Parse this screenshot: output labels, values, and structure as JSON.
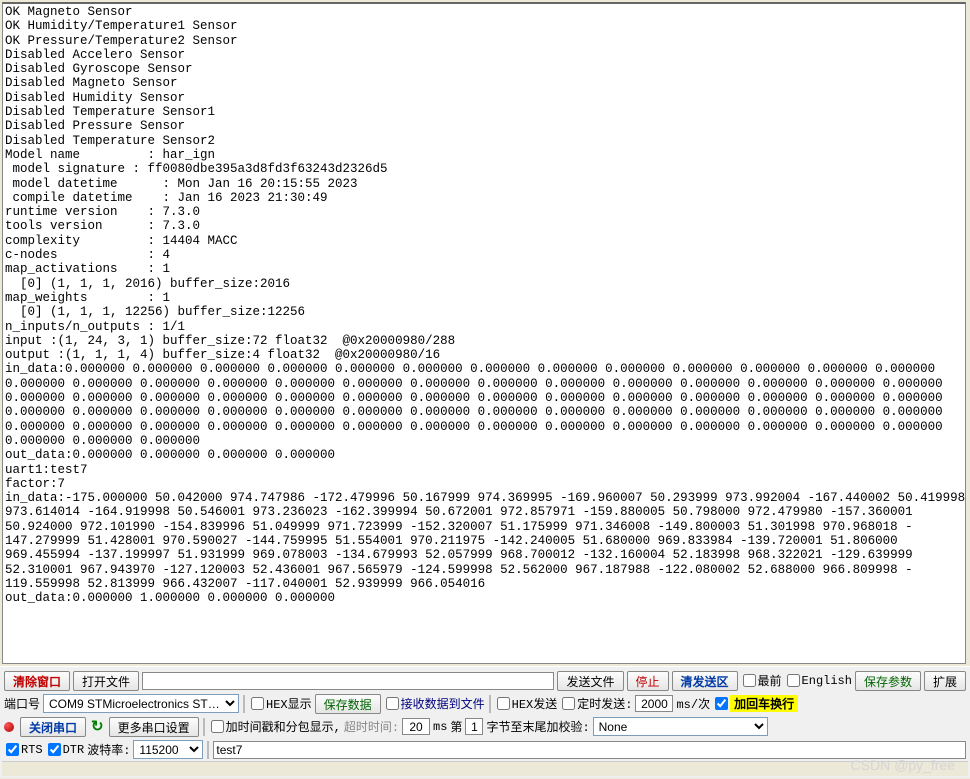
{
  "output_lines": [
    "OK Magneto Sensor",
    "OK Humidity/Temperature1 Sensor",
    "OK Pressure/Temperature2 Sensor",
    "Disabled Accelero Sensor",
    "Disabled Gyroscope Sensor",
    "Disabled Magneto Sensor",
    "Disabled Humidity Sensor",
    "Disabled Temperature Sensor1",
    "Disabled Pressure Sensor",
    "Disabled Temperature Sensor2",
    "Model name         : har_ign",
    " model signature : ff0080dbe395a3d8fd3f63243d2326d5",
    " model datetime      : Mon Jan 16 20:15:55 2023",
    " compile datetime    : Jan 16 2023 21:30:49",
    "runtime version    : 7.3.0",
    "tools version      : 7.3.0",
    "complexity         : 14404 MACC",
    "c-nodes            : 4",
    "map_activations    : 1",
    "  [0] (1, 1, 1, 2016) buffer_size:2016",
    "map_weights        : 1",
    "  [0] (1, 1, 1, 12256) buffer_size:12256",
    "n_inputs/n_outputs : 1/1",
    "input :(1, 24, 3, 1) buffer_size:72 float32  @0x20000980/288",
    "output :(1, 1, 1, 4) buffer_size:4 float32  @0x20000980/16",
    "in_data:0.000000 0.000000 0.000000 0.000000 0.000000 0.000000 0.000000 0.000000 0.000000 0.000000 0.000000 0.000000 0.000000",
    "0.000000 0.000000 0.000000 0.000000 0.000000 0.000000 0.000000 0.000000 0.000000 0.000000 0.000000 0.000000 0.000000 0.000000",
    "0.000000 0.000000 0.000000 0.000000 0.000000 0.000000 0.000000 0.000000 0.000000 0.000000 0.000000 0.000000 0.000000 0.000000",
    "0.000000 0.000000 0.000000 0.000000 0.000000 0.000000 0.000000 0.000000 0.000000 0.000000 0.000000 0.000000 0.000000 0.000000",
    "0.000000 0.000000 0.000000 0.000000 0.000000 0.000000 0.000000 0.000000 0.000000 0.000000 0.000000 0.000000 0.000000 0.000000",
    "0.000000 0.000000 0.000000",
    "out_data:0.000000 0.000000 0.000000 0.000000",
    "uart1:test7",
    "factor:7",
    "in_data:-175.000000 50.042000 974.747986 -172.479996 50.167999 974.369995 -169.960007 50.293999 973.992004 -167.440002 50.419998",
    "973.614014 -164.919998 50.546001 973.236023 -162.399994 50.672001 972.857971 -159.880005 50.798000 972.479980 -157.360001",
    "50.924000 972.101990 -154.839996 51.049999 971.723999 -152.320007 51.175999 971.346008 -149.800003 51.301998 970.968018 -",
    "147.279999 51.428001 970.590027 -144.759995 51.554001 970.211975 -142.240005 51.680000 969.833984 -139.720001 51.806000",
    "969.455994 -137.199997 51.931999 969.078003 -134.679993 52.057999 968.700012 -132.160004 52.183998 968.322021 -129.639999",
    "52.310001 967.943970 -127.120003 52.436001 967.565979 -124.599998 52.562000 967.187988 -122.080002 52.688000 966.809998 -",
    "119.559998 52.813999 966.432007 -117.040001 52.939999 966.054016",
    "out_data:0.000000 1.000000 0.000000 0.000000",
    ""
  ],
  "toolbar1": {
    "clear_window": "清除窗口",
    "open_file": "打开文件",
    "send_file": "发送文件",
    "stop": "停止",
    "clear_send": "清发送区",
    "front": "最前",
    "english": "English",
    "save_params": "保存参数",
    "expand": "扩展"
  },
  "toolbar2": {
    "port_label": "端口号",
    "port_value": "COM9 STMicroelectronics ST…",
    "hex_display": "HEX显示",
    "save_data": "保存数据",
    "recv_to_file": "接收数据到文件",
    "hex_send": "HEX发送",
    "timed_send": "定时发送:",
    "timed_value": "2000",
    "ms_per": "ms/次",
    "add_crlf": "加回车换行"
  },
  "toolbar3": {
    "close_port": "关闭串口",
    "more_settings": "更多串口设置",
    "timestamp_label": "加时间戳和分包显示,",
    "timeout_label": "超时时间: ",
    "timeout_value": "20",
    "ms": "ms",
    "nth_label": "第",
    "nth_value": "1",
    "checksum_label": "字节至末尾加校验:",
    "checksum_value": "None"
  },
  "toolbar4": {
    "rts": "RTS",
    "dtr": "DTR",
    "baud_label": "波特率:",
    "baud_value": "115200",
    "send_text": "test7"
  },
  "watermark": "CSDN @py_free"
}
